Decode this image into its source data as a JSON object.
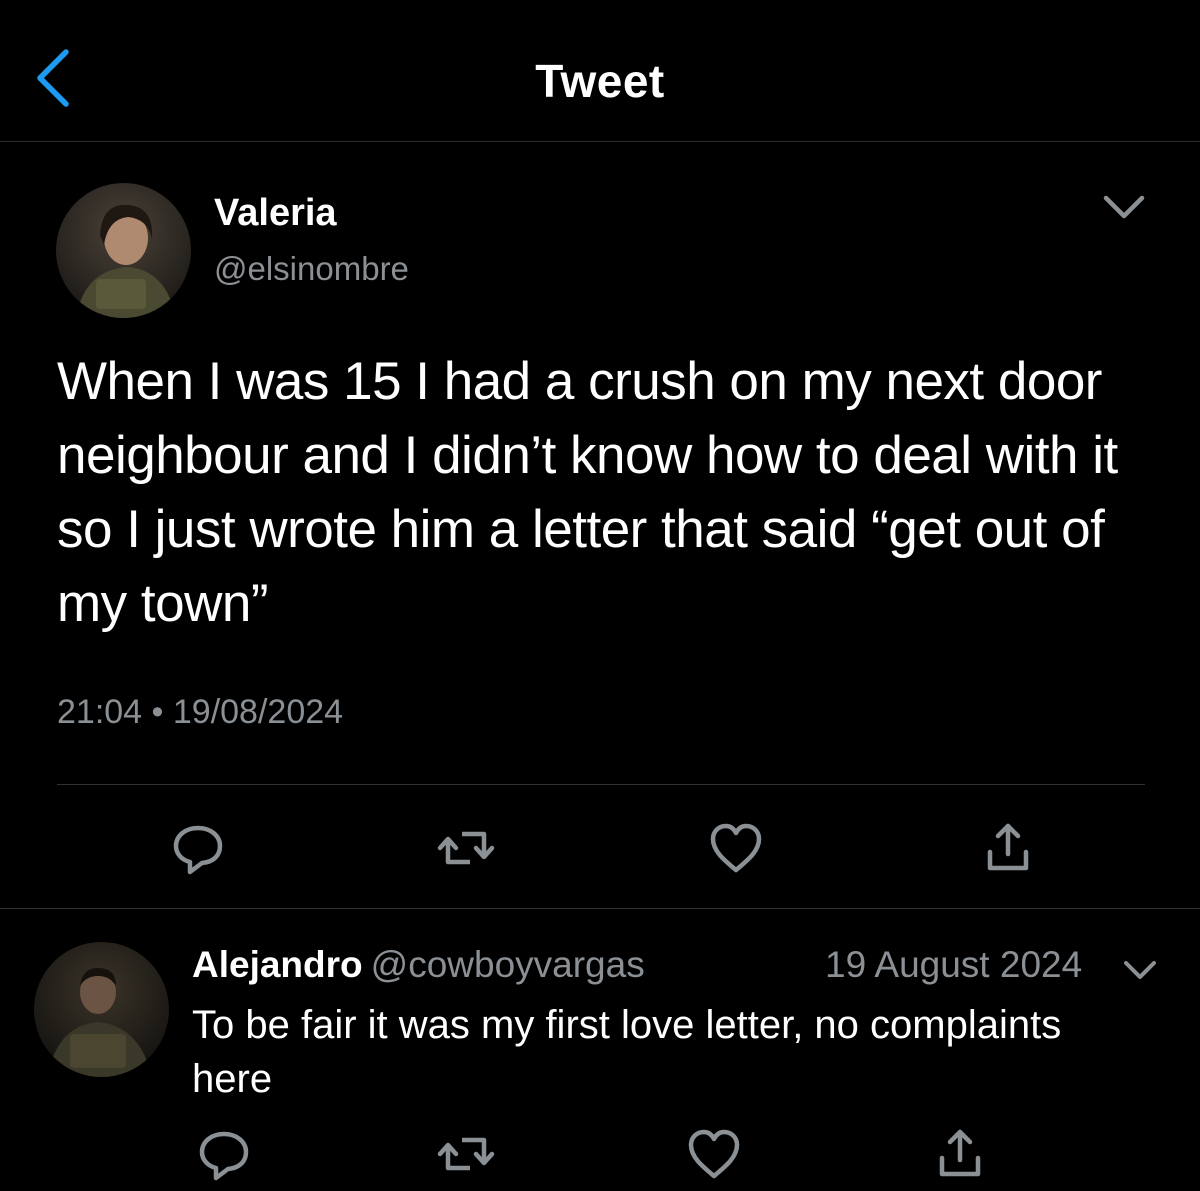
{
  "header": {
    "title": "Tweet",
    "back_icon": "chevron-left-icon",
    "accent": "#1d9bf0"
  },
  "tweet": {
    "author_name": "Valeria",
    "author_handle": "@elsinombre",
    "text": "When I was 15 I had a crush on my next door neighbour and I didn’t know how to deal with it so I just wrote him a letter that said “get out of my town”",
    "timestamp": "21:04 • 19/08/2024",
    "actions": [
      "reply-icon",
      "retweet-icon",
      "like-icon",
      "share-icon"
    ]
  },
  "reply": {
    "author_name": "Alejandro",
    "author_handle": "@cowboyvargas",
    "date": "19 August 2024",
    "text": "To be fair it was my first love letter, no complaints here",
    "actions": [
      "reply-icon",
      "retweet-icon",
      "like-icon",
      "share-icon"
    ]
  },
  "colors": {
    "background": "#000000",
    "text": "#ffffff",
    "secondary": "#8b9095",
    "divider": "#2f3336"
  }
}
